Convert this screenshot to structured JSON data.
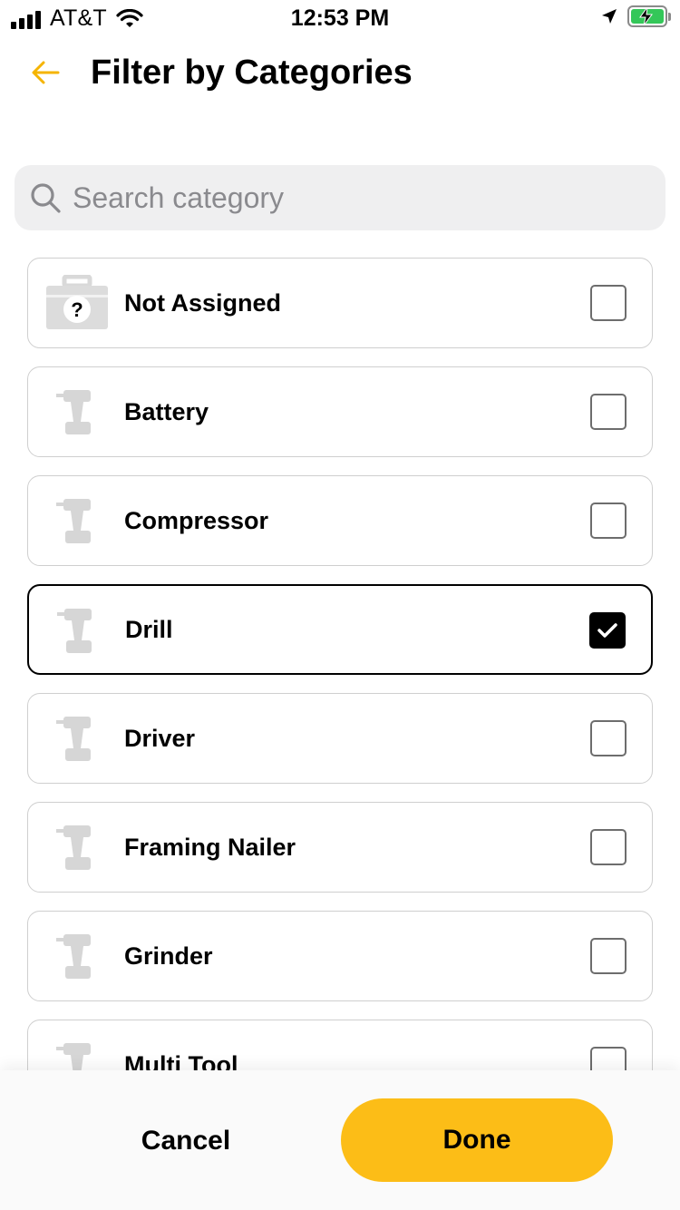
{
  "status_bar": {
    "carrier": "AT&T",
    "time": "12:53 PM"
  },
  "header": {
    "title": "Filter by Categories",
    "accent_color": "#f5b400"
  },
  "search": {
    "placeholder": "Search category",
    "value": ""
  },
  "categories": [
    {
      "label": "Not Assigned",
      "icon": "unknown-toolbox-icon",
      "checked": false
    },
    {
      "label": "Battery",
      "icon": "drill-icon",
      "checked": false
    },
    {
      "label": "Compressor",
      "icon": "drill-icon",
      "checked": false
    },
    {
      "label": "Drill",
      "icon": "drill-icon",
      "checked": true
    },
    {
      "label": "Driver",
      "icon": "drill-icon",
      "checked": false
    },
    {
      "label": "Framing Nailer",
      "icon": "drill-icon",
      "checked": false
    },
    {
      "label": "Grinder",
      "icon": "drill-icon",
      "checked": false
    },
    {
      "label": "Multi Tool",
      "icon": "drill-icon",
      "checked": false
    }
  ],
  "footer": {
    "cancel_label": "Cancel",
    "done_label": "Done",
    "done_color": "#fcbd17"
  }
}
